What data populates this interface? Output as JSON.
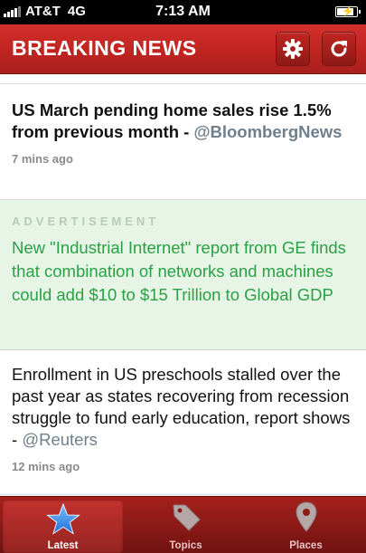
{
  "status_bar": {
    "carrier": "AT&T",
    "network": "4G",
    "time": "7:13 AM"
  },
  "header": {
    "title": "BREAKING NEWS",
    "settings_icon": "gear-icon",
    "refresh_icon": "refresh-icon"
  },
  "feed": {
    "stories": [
      {
        "headline": "US March pending home sales rise 1.5% from previous month - ",
        "source": "@BloombergNews",
        "time": "7 mins ago"
      },
      {
        "headline": "Enrollment in US preschools stalled over the past year as states recovering from recession struggle to fund early education, report shows - ",
        "source": "@Reuters",
        "time": "12 mins ago"
      }
    ],
    "ad": {
      "label": "ADVERTISEMENT",
      "text": "New \"Industrial Internet\" report from GE finds that combination of networks and machines could add $10 to $15 Trillion to Global GDP"
    }
  },
  "tabbar": {
    "tabs": [
      {
        "label": "Latest",
        "icon": "star-icon",
        "active": true
      },
      {
        "label": "Topics",
        "icon": "tag-icon",
        "active": false
      },
      {
        "label": "Places",
        "icon": "map-pin-icon",
        "active": false
      }
    ]
  },
  "colors": {
    "brand_red": "#c22521",
    "ad_green": "#2aa144",
    "ad_background": "#e6f5e6",
    "source_gray": "#6f7f8c",
    "star_blue": "#3a8ee8"
  }
}
